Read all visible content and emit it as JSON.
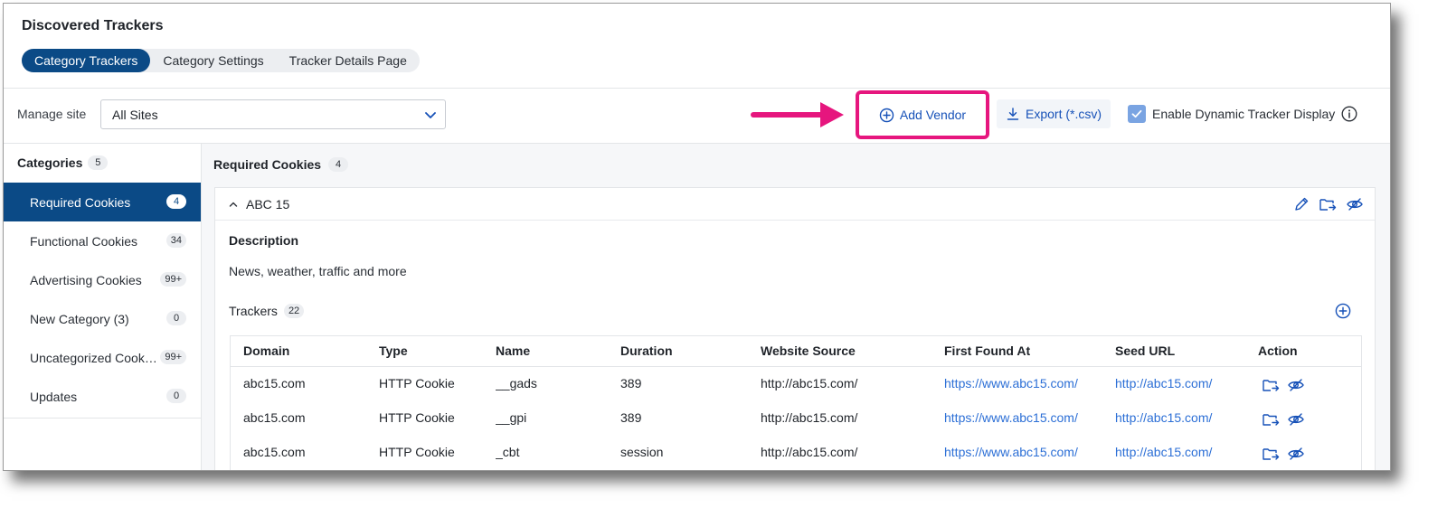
{
  "page": {
    "title": "Discovered Trackers",
    "tabs": [
      {
        "label": "Category Trackers",
        "active": true
      },
      {
        "label": "Category Settings",
        "active": false
      },
      {
        "label": "Tracker Details Page",
        "active": false
      }
    ]
  },
  "toolbar": {
    "manage_site_label": "Manage site",
    "site_select_value": "All Sites",
    "add_vendor_label": "Add Vendor",
    "export_label": "Export (*.csv)",
    "dynamic_display_label": "Enable Dynamic Tracker Display",
    "dynamic_display_checked": true,
    "highlight_color": "#e6167e"
  },
  "sidebar": {
    "heading": "Categories",
    "count": "5",
    "items": [
      {
        "label": "Required Cookies",
        "count": "4",
        "active": true
      },
      {
        "label": "Functional Cookies",
        "count": "34",
        "active": false
      },
      {
        "label": "Advertising Cookies",
        "count": "99+",
        "active": false
      },
      {
        "label": "New Category (3)",
        "count": "0",
        "active": false
      },
      {
        "label": "Uncategorized Cookies",
        "count": "99+",
        "active": false
      },
      {
        "label": "Updates",
        "count": "0",
        "active": false
      }
    ]
  },
  "main": {
    "heading": "Required Cookies",
    "count": "4",
    "vendor": {
      "name": "ABC 15",
      "description_label": "Description",
      "description": "News, weather, traffic and more",
      "trackers_label": "Trackers",
      "trackers_count": "22"
    },
    "table": {
      "columns": [
        "Domain",
        "Type",
        "Name",
        "Duration",
        "Website Source",
        "First Found At",
        "Seed URL",
        "Action"
      ],
      "rows": [
        {
          "domain": "abc15.com",
          "type": "HTTP Cookie",
          "name": "__gads",
          "duration": "389",
          "website_source": "http://abc15.com/",
          "first_found_at": "https://www.abc15.com/",
          "seed_url": "http://abc15.com/"
        },
        {
          "domain": "abc15.com",
          "type": "HTTP Cookie",
          "name": "__gpi",
          "duration": "389",
          "website_source": "http://abc15.com/",
          "first_found_at": "https://www.abc15.com/",
          "seed_url": "http://abc15.com/"
        },
        {
          "domain": "abc15.com",
          "type": "HTTP Cookie",
          "name": "_cbt",
          "duration": "session",
          "website_source": "http://abc15.com/",
          "first_found_at": "https://www.abc15.com/",
          "seed_url": "http://abc15.com/"
        }
      ]
    }
  },
  "colors": {
    "primary": "#0b4a86",
    "link": "#2c6fd6",
    "icon": "#1651b8"
  }
}
